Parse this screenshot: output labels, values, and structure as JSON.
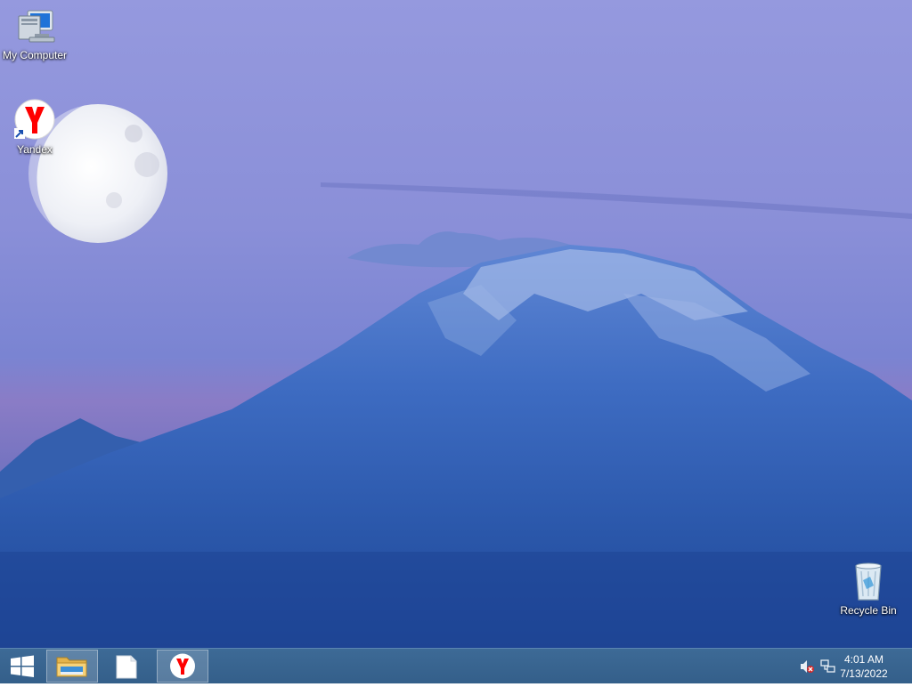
{
  "desktop": {
    "icons": [
      {
        "label": "My Computer",
        "icon": "computer-icon"
      },
      {
        "label": "Yandex",
        "icon": "yandex-browser-icon"
      },
      {
        "label": "Recycle Bin",
        "icon": "recycle-bin-icon"
      }
    ]
  },
  "taskbar": {
    "buttons": [
      {
        "icon": "windows-start-icon",
        "active": false
      },
      {
        "icon": "file-explorer-icon",
        "active": true
      },
      {
        "icon": "blank-document-icon",
        "active": false
      },
      {
        "icon": "yandex-browser-icon",
        "active": true
      }
    ],
    "tray": {
      "icons": [
        "speaker-muted-icon",
        "network-icon"
      ]
    },
    "clock": {
      "time": "4:01 AM",
      "date": "7/13/2022"
    }
  },
  "colors": {
    "sky": "#8f93dc",
    "mountain": "#2d5ab0",
    "taskbar": "#3d6a96",
    "yandex_red": "#ff0000"
  }
}
